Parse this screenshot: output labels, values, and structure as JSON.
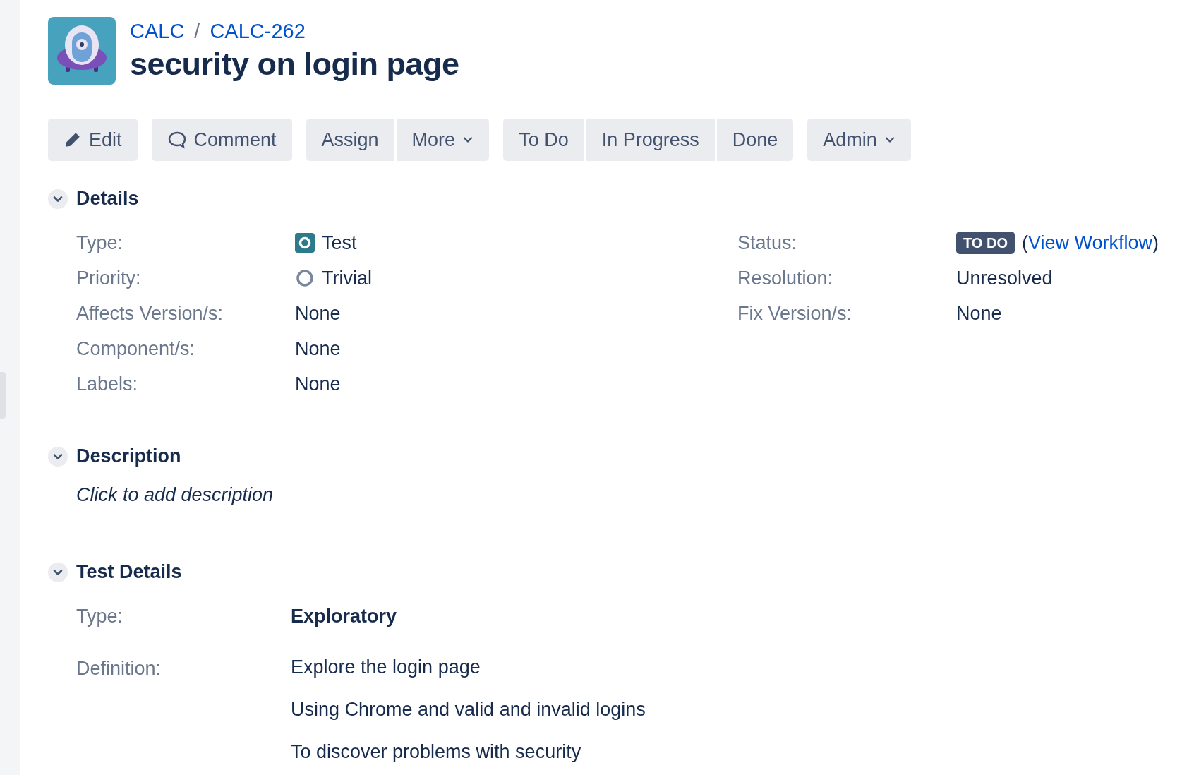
{
  "breadcrumb": {
    "project": "CALC",
    "separator": "/",
    "issue_key": "CALC-262"
  },
  "title": "security on login page",
  "toolbar": [
    {
      "buttons": [
        {
          "label": "Edit",
          "kind": "edit"
        }
      ]
    },
    {
      "buttons": [
        {
          "label": "Comment",
          "kind": "comment"
        }
      ]
    },
    {
      "buttons": [
        {
          "label": "Assign",
          "kind": "plain"
        },
        {
          "label": "More",
          "kind": "dropdown"
        }
      ]
    },
    {
      "buttons": [
        {
          "label": "To Do",
          "kind": "plain"
        },
        {
          "label": "In Progress",
          "kind": "plain"
        },
        {
          "label": "Done",
          "kind": "plain"
        }
      ]
    },
    {
      "buttons": [
        {
          "label": "Admin",
          "kind": "dropdown"
        }
      ]
    }
  ],
  "details": {
    "heading": "Details",
    "expanded": true,
    "left": [
      {
        "label": "Type:",
        "value": "Test",
        "kind": "issue-type"
      },
      {
        "label": "Priority:",
        "value": "Trivial",
        "kind": "priority"
      },
      {
        "label": "Affects Version/s:",
        "value": "None",
        "kind": "text"
      },
      {
        "label": "Component/s:",
        "value": "None",
        "kind": "text"
      },
      {
        "label": "Labels:",
        "value": "None",
        "kind": "text"
      }
    ],
    "right": [
      {
        "label": "Status:",
        "kind": "status",
        "lozenge": "TO DO",
        "before": "(",
        "link": "View Workflow",
        "after": ")"
      },
      {
        "label": "Resolution:",
        "value": "Unresolved",
        "kind": "text"
      },
      {
        "label": "Fix Version/s:",
        "value": "None",
        "kind": "text"
      }
    ]
  },
  "description": {
    "heading": "Description",
    "expanded": true,
    "text": "Click to add description"
  },
  "test_details": {
    "heading": "Test Details",
    "expanded": true,
    "type_label": "Type:",
    "type_value": "Exploratory",
    "definition_label": "Definition:",
    "definition_lines": [
      "Explore the login page",
      "Using Chrome and valid and invalid logins",
      "To discover problems with security"
    ]
  }
}
